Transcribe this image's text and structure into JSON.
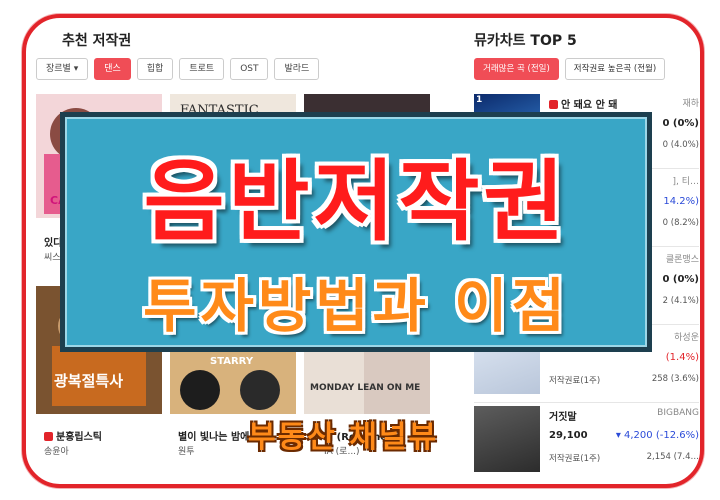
{
  "left_panel": {
    "title": "추천 저작권",
    "chips": [
      "장르별 ▾",
      "댄스",
      "힙합",
      "트로트",
      "OST",
      "발라드"
    ],
    "active_chip_index": 1,
    "cards": [
      {
        "cover_text": "CASSTAR",
        "title": "있다",
        "subtitle": "씨스"
      },
      {
        "cover_text": "FANTASTIC",
        "title": "",
        "subtitle": ""
      },
      {
        "cover_text": "",
        "title": "",
        "subtitle": ""
      },
      {
        "cover_text": "광복절특사",
        "title": "분홍립스틱",
        "subtitle": "송윤아",
        "badge": true
      },
      {
        "cover_text": "STARRY",
        "title": "별이 빛나는 밤에",
        "subtitle": "원투"
      },
      {
        "cover_text": "MONDAY LEAN ON ME",
        "title": "지 (Ro...show)",
        "subtitle": "IA (로...)"
      }
    ]
  },
  "right_panel": {
    "title": "뮤카차트 TOP 5",
    "tabs": [
      "거래많은 곡 (전일)",
      "저작권료 높은곡 (전월)"
    ],
    "active_tab_index": 0,
    "rows": [
      {
        "rank": "1",
        "song": "안 돼요 안 돼",
        "artist": "재하",
        "price": "",
        "change": "0 (0%)",
        "change_color": "zero",
        "sub_label": "",
        "sub_value": "0 (4.0%)"
      },
      {
        "rank": "",
        "song": "",
        "artist": "], 티…",
        "price": "",
        "change": "14.2%)",
        "change_color": "blue",
        "sub_label": "",
        "sub_value": "0 (8.2%)"
      },
      {
        "rank": "",
        "song": "",
        "artist": "클론맹스",
        "price": "",
        "change": "0 (0%)",
        "change_color": "zero",
        "sub_label": "",
        "sub_value": "2 (4.1%)"
      },
      {
        "rank": "",
        "song": "",
        "artist": "하성운",
        "price": "",
        "change": "(1.4%)",
        "change_color": "red",
        "sub_label": "저작권료(1주)",
        "sub_value": "258 (3.6%)"
      },
      {
        "rank": "",
        "song": "거짓말",
        "artist": "BIGBANG",
        "price": "29,100",
        "change": "▾ 4,200 (-12.6%)",
        "change_color": "blue",
        "sub_label": "저작권료(1주)",
        "sub_value": "2,154 (7.4…"
      }
    ]
  },
  "overlay": {
    "title": "음반저작권",
    "subtitle": "투자방법과 이점"
  },
  "watermark": "부동산 채널뷰",
  "colors": {
    "frame_border": "#e2242a",
    "accent_red": "#f04d56",
    "overlay_bg": "#39a6c6",
    "title_red": "#ff1c1c",
    "subtitle_orange": "#ff8a19"
  }
}
